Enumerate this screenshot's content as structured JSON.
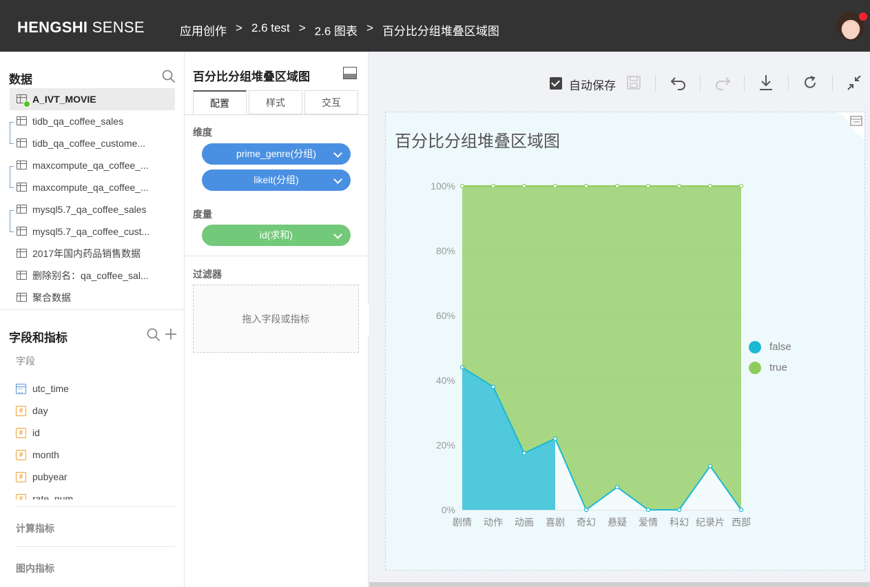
{
  "header": {
    "brand_bold": "HENGSHI",
    "brand_rest": "SENSE",
    "breadcrumbs": [
      "应用创作",
      "2.6 test",
      "2.6 图表",
      "百分比分组堆叠区域图"
    ],
    "separator": ">"
  },
  "left": {
    "data_title": "数据",
    "datasets": [
      "A_IVT_MOVIE",
      "tidb_qa_coffee_sales",
      "tidb_qa_coffee_custome...",
      "maxcompute_qa_coffee_...",
      "maxcompute_qa_coffee_...",
      "mysql5.7_qa_coffee_sales",
      "mysql5.7_qa_coffee_cust...",
      "2017年国内药品销售数据",
      "删除别名：qa_coffee_sal...",
      "聚合数据"
    ],
    "fields_title": "字段和指标",
    "fields_label": "字段",
    "fields": [
      {
        "name": "utc_time",
        "type": "date"
      },
      {
        "name": "day",
        "type": "number"
      },
      {
        "name": "id",
        "type": "number"
      },
      {
        "name": "month",
        "type": "number"
      },
      {
        "name": "pubyear",
        "type": "number"
      },
      {
        "name": "rate_num",
        "type": "number"
      }
    ],
    "calc_metrics": "计算指标",
    "chart_metrics": "图内指标",
    "hash_symbol": "#"
  },
  "config": {
    "title": "百分比分组堆叠区域图",
    "tabs": [
      "配置",
      "样式",
      "交互"
    ],
    "dimension_label": "维度",
    "dimensions": [
      "prime_genre(分组)",
      "likeit(分组)"
    ],
    "measure_label": "度量",
    "measures": [
      "id(求和)"
    ],
    "filter_label": "过滤器",
    "filter_placeholder": "拖入字段或指标"
  },
  "toolbar": {
    "autosave_label": "自动保存",
    "autosave_checked": true
  },
  "colors": {
    "false_series": "#1bb8d3",
    "true_series": "#8fcb5a",
    "pill_blue": "#4a90e2",
    "pill_green": "#73c97a"
  },
  "chart_data": {
    "type": "area",
    "title": "百分比分组堆叠区域图",
    "categories": [
      "剧情",
      "动作",
      "动画",
      "喜剧",
      "奇幻",
      "悬疑",
      "爱情",
      "科幻",
      "纪录片",
      "西部"
    ],
    "series": [
      {
        "name": "false",
        "values": [
          44,
          38,
          17.5,
          22,
          0,
          7,
          0,
          0,
          13.5,
          0
        ]
      },
      {
        "name": "true",
        "values": [
          56,
          62,
          82.5,
          78,
          100,
          93,
          100,
          100,
          86.5,
          100
        ]
      }
    ],
    "stacked": "percent",
    "ylim": [
      0,
      100
    ],
    "yticks": [
      "0%",
      "20%",
      "40%",
      "60%",
      "80%",
      "100%"
    ],
    "legend": "right",
    "grid": true
  }
}
